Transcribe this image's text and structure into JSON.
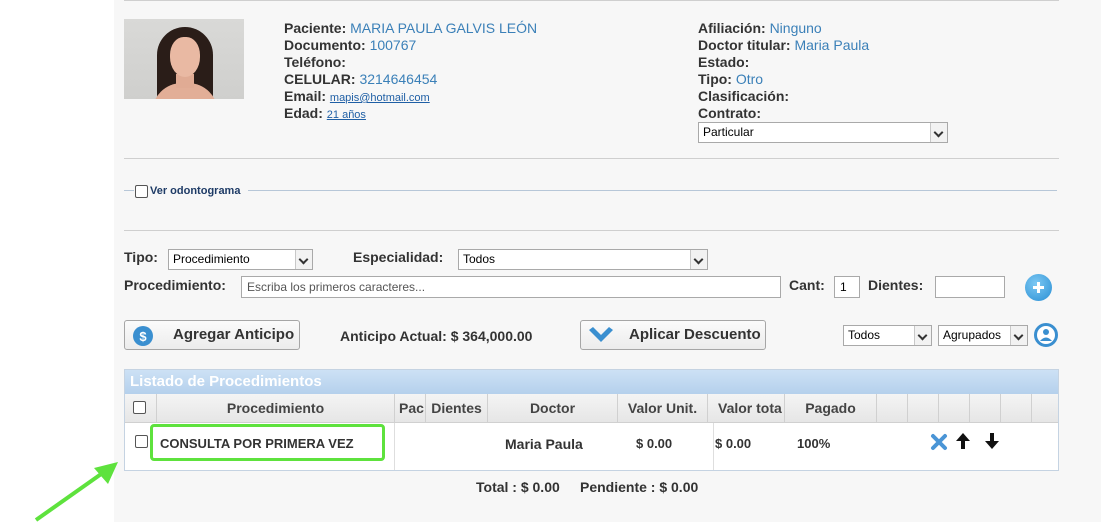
{
  "patient": {
    "labels": {
      "paciente": "Paciente:",
      "documento": "Documento:",
      "telefono": "Teléfono:",
      "celular": "CELULAR:",
      "email": "Email:",
      "edad": "Edad:"
    },
    "paciente": "MARIA PAULA GALVIS LEÓN",
    "documento": "100767",
    "telefono": "",
    "celular": "3214646454",
    "email": "mapis@hotmail.com",
    "edad": "21 años"
  },
  "affiliation": {
    "labels": {
      "afiliacion": "Afiliación:",
      "doctor": "Doctor titular:",
      "estado": "Estado:",
      "tipo": "Tipo:",
      "clasificacion": "Clasificación:",
      "contrato": "Contrato:"
    },
    "afiliacion": "Ninguno",
    "doctor": "Maria Paula",
    "estado": "",
    "tipo": "Otro",
    "clasificacion": "",
    "contrato": "Particular"
  },
  "odontograma": {
    "label": "Ver odontograma"
  },
  "filters": {
    "tipo_label": "Tipo:",
    "tipo_value": "Procedimiento",
    "especialidad_label": "Especialidad:",
    "especialidad_value": "Todos",
    "procedimiento_label": "Procedimiento:",
    "procedimiento_placeholder": "Escriba los primeros caracteres...",
    "cant_label": "Cant:",
    "cant_value": "1",
    "dientes_label": "Dientes:",
    "dientes_value": ""
  },
  "actions": {
    "agregar_anticipo": "Agregar Anticipo",
    "anticipo_actual": "Anticipo Actual: $ 364,000.00",
    "aplicar_descuento": "Aplicar Descuento",
    "filter1": "Todos",
    "filter2": "Agrupados"
  },
  "table": {
    "title": "Listado de Procedimientos",
    "headers": [
      "Procedimiento",
      "Pac",
      "Dientes",
      "Doctor",
      "Valor Unit.",
      "Valor tota",
      "Pagado"
    ],
    "rows": [
      {
        "procedimiento": "CONSULTA POR PRIMERA VEZ",
        "doctor": "Maria Paula",
        "valor_unit": "$ 0.00",
        "valor_total": "$ 0.00",
        "pagado": "100%"
      }
    ]
  },
  "totals": {
    "total": "Total : $ 0.00",
    "pendiente": "Pendiente : $ 0.00"
  },
  "colors": {
    "accent_blue": "#3b80b8",
    "highlight_green": "#5ee23d",
    "arrow_green": "#5ee23d"
  }
}
